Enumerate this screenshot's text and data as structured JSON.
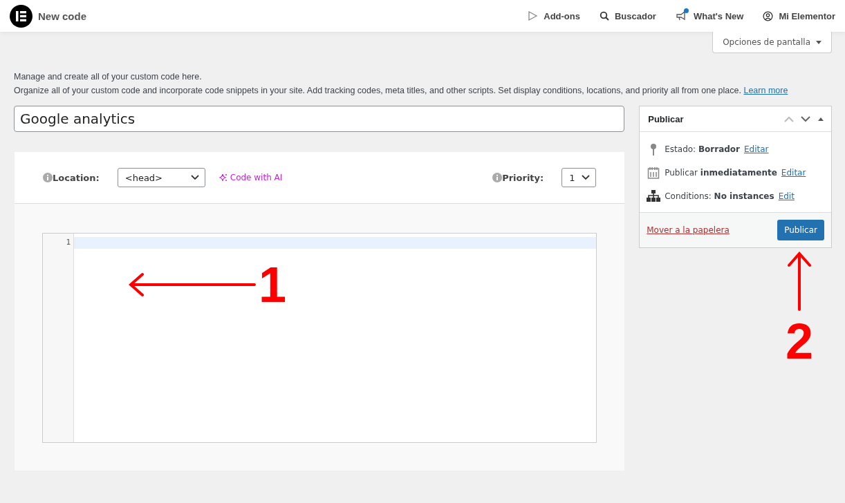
{
  "topbar": {
    "title": "New code",
    "nav": [
      {
        "kind": "addons",
        "label": "Add-ons",
        "badge": false
      },
      {
        "kind": "search",
        "label": "Buscador",
        "badge": false
      },
      {
        "kind": "news",
        "label": "What's New",
        "badge": true
      },
      {
        "kind": "account",
        "label": "Mi Elementor",
        "badge": false
      }
    ]
  },
  "screen_options": "Opciones de pantalla",
  "intro": {
    "line_1": "Manage and create all of your custom code here.",
    "line_2": "Organize all of your custom code and incorporate code snippets in your site. Add tracking codes, meta titles, and other scripts. Set display conditions, locations, and priority all from one place.",
    "link": "Learn more"
  },
  "title_field": {
    "value": "Google analytics"
  },
  "toolbar": {
    "location_label": "Location:",
    "location_value": "<head>",
    "ai_button": "Code with AI",
    "priority_label": "Priority:",
    "priority_value": "1"
  },
  "editor": {
    "line_numbers": [
      "1"
    ]
  },
  "publish_box": {
    "title": "Publicar",
    "rows": [
      {
        "kind": "status",
        "text": "Estado: ",
        "strong": "Borrador",
        "link": "Editar"
      },
      {
        "kind": "schedule",
        "text": "Publicar ",
        "strong": "inmediatamente",
        "link": "Editar"
      },
      {
        "kind": "conditions",
        "text": "Conditions: ",
        "strong": "No instances",
        "link": "Edit"
      }
    ],
    "trash_link": "Mover a la papelera",
    "publish_button": "Publicar"
  },
  "annotations": [
    {
      "kind": "left",
      "label": "1"
    },
    {
      "kind": "up",
      "label": "2"
    }
  ]
}
